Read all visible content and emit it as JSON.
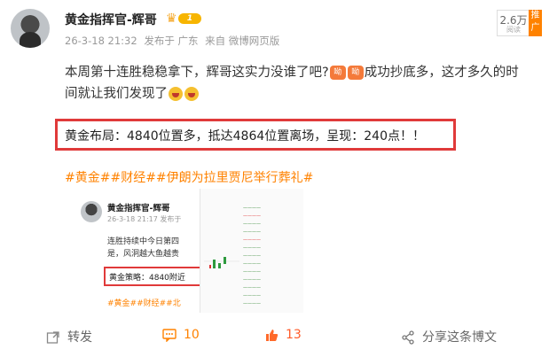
{
  "post": {
    "author": "黄金指挥官-辉哥",
    "vip_level": "1",
    "time": "26-3-18 21:32",
    "location": "发布于 广东",
    "source": "来自 微博网页版",
    "fans": "2.6万",
    "fans_label": "阅读",
    "promo": "推广",
    "line1_a": "本周第十连胜稳稳拿下，辉哥这实力没谁了吧?",
    "emoji_tag": "呦",
    "line1_b": "成功抄底多，这才多久的时",
    "line2": "间就让我们发现了",
    "highlight": "黄金布局：4840位置多，抵达4864位置离场，呈现：240点！！",
    "hashtags": "#黄金##财经##伊朗为拉里贾尼举行葬礼#"
  },
  "embed": {
    "author": "黄金指挥官-辉哥",
    "meta": "26-3-18 21:17  发布于",
    "line1": "连胜持续中今日第四",
    "line2": "是，风泂越大鱼越贵",
    "box": "黄金策略：4840附近",
    "tags": "#黄金##财经##北"
  },
  "actions": {
    "repost": "转发",
    "comments": "10",
    "likes": "13",
    "share": "分享这条博文"
  },
  "colors": {
    "accent": "#ff8200",
    "highlight_border": "#e03a3a"
  }
}
